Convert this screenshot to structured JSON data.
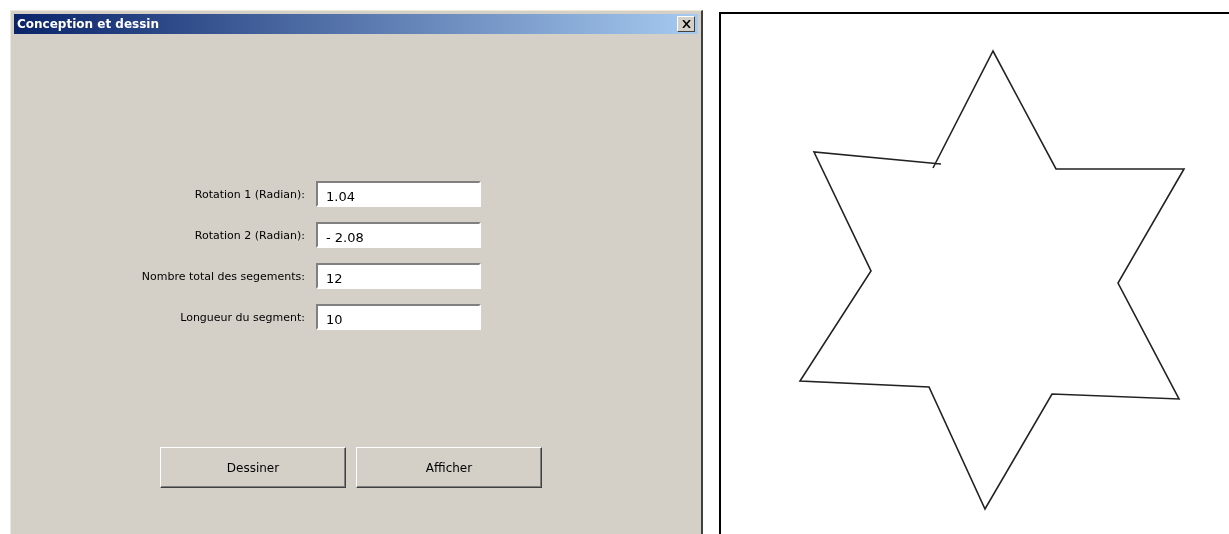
{
  "window": {
    "title": "Conception et dessin"
  },
  "fields": [
    {
      "label": "Rotation 1 (Radian):",
      "value": "1.04"
    },
    {
      "label": "Rotation 2 (Radian):",
      "value": "- 2.08"
    },
    {
      "label": "Nombre total des segements:",
      "value": "12"
    },
    {
      "label": "Longueur du segment:",
      "value": "10"
    }
  ],
  "buttons": [
    "Dessiner",
    "Afficher"
  ],
  "canvas": {
    "kind": "drawing"
  }
}
